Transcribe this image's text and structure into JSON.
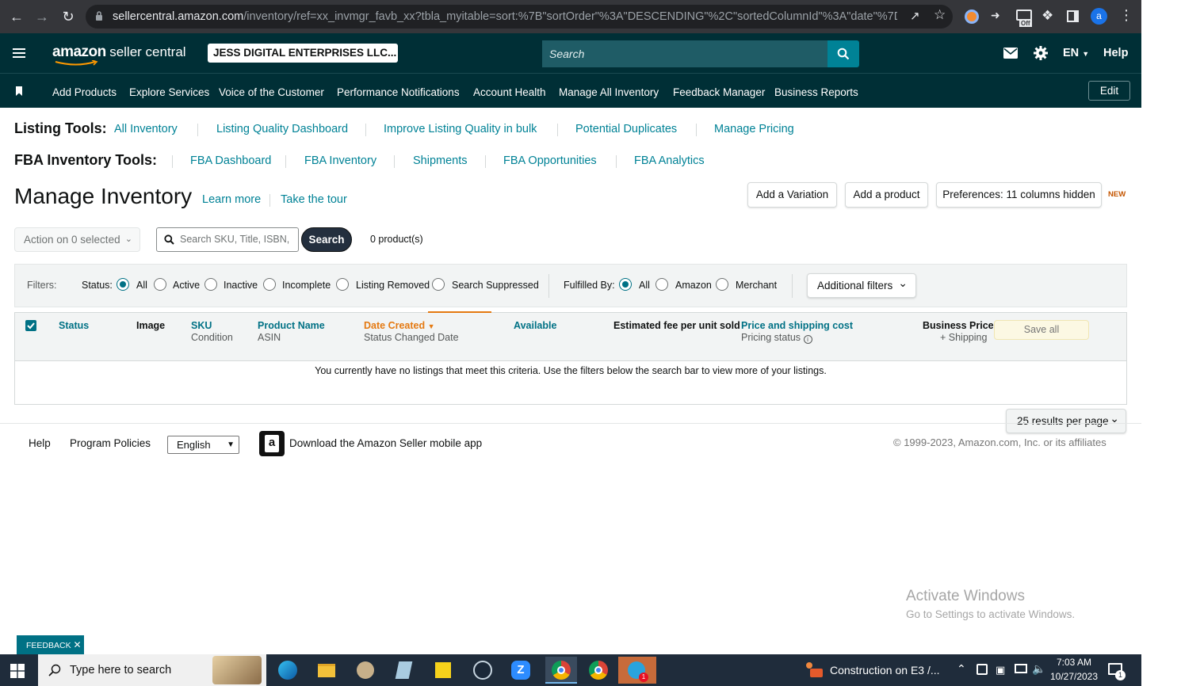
{
  "browser": {
    "url_host": "sellercentral.amazon.com",
    "url_path": "/inventory/ref=xx_invmgr_favb_xx?tbla_myitable=sort:%7B\"sortOrder\"%3A\"DESCENDING\"%2C\"sortedColumnId\"%3A\"date\"%7D;searc...",
    "profile_initial": "a",
    "extension_badge": "Off"
  },
  "header": {
    "logo_amazon": "amazon",
    "logo_seller": "seller central",
    "account_name": "JESS DIGITAL ENTERPRISES LLC...",
    "search_placeholder": "Search",
    "language": "EN",
    "help": "Help"
  },
  "navbar": {
    "items": [
      "Add Products",
      "Explore Services",
      "Voice of the Customer",
      "Performance Notifications",
      "Account Health",
      "Manage All Inventory",
      "Feedback Manager",
      "Business Reports"
    ],
    "edit": "Edit"
  },
  "listing_tools": {
    "label": "Listing Tools:",
    "links": [
      "All Inventory",
      "Listing Quality Dashboard",
      "Improve Listing Quality in bulk",
      "Potential Duplicates",
      "Manage Pricing"
    ]
  },
  "fba_tools": {
    "label": "FBA Inventory Tools:",
    "links": [
      "FBA Dashboard",
      "FBA Inventory",
      "Shipments",
      "FBA Opportunities",
      "FBA Analytics"
    ]
  },
  "page": {
    "title": "Manage Inventory",
    "learn_more": "Learn more",
    "take_tour": "Take the tour",
    "add_variation": "Add a Variation",
    "add_product": "Add a product",
    "preferences": "Preferences: 11 columns hidden",
    "new_badge": "NEW"
  },
  "actions": {
    "action_select": "Action on 0 selected",
    "search_placeholder": "Search SKU, Title, ISBN,",
    "search_button": "Search",
    "product_count": "0 product(s)"
  },
  "filters": {
    "label": "Filters:",
    "status_label": "Status:",
    "status_options": [
      "All",
      "Active",
      "Inactive",
      "Incomplete",
      "Listing Removed",
      "Search Suppressed"
    ],
    "status_selected": "All",
    "fulfilled_label": "Fulfilled By:",
    "fulfilled_options": [
      "All",
      "Amazon",
      "Merchant"
    ],
    "fulfilled_selected": "All",
    "additional": "Additional filters"
  },
  "table": {
    "columns": {
      "status": "Status",
      "image": "Image",
      "sku": "SKU",
      "sku_sub": "Condition",
      "product_name": "Product Name",
      "product_sub": "ASIN",
      "date_created": "Date Created",
      "date_sub": "Status Changed Date",
      "available": "Available",
      "fee": "Estimated fee per unit sold",
      "price": "Price and shipping cost",
      "price_sub": "Pricing status",
      "business": "Business Price",
      "business_sub": "+ Shipping",
      "save_all": "Save all"
    },
    "empty_message": "You currently have no listings that meet this criteria. Use the filters below the search bar to view more of your listings.",
    "per_page": "25 results per page"
  },
  "footer": {
    "help": "Help",
    "policies": "Program Policies",
    "language": "English",
    "app": "Download the Amazon Seller mobile app",
    "copyright": "© 1999-2023, Amazon.com, Inc. or its affiliates"
  },
  "watermark": {
    "line1": "Activate Windows",
    "line2": "Go to Settings to activate Windows."
  },
  "feedback": "FEEDBACK",
  "taskbar": {
    "search_placeholder": "Type here to search",
    "notification_text": "Construction on E3 /...",
    "time": "7:03 AM",
    "date": "10/27/2023",
    "notif_count": "1"
  },
  "colors": {
    "header_bg": "#002f36",
    "search_bg": "#1f5c66",
    "search_btn": "#008296",
    "link": "#008296",
    "sort_accent": "#e47911"
  }
}
